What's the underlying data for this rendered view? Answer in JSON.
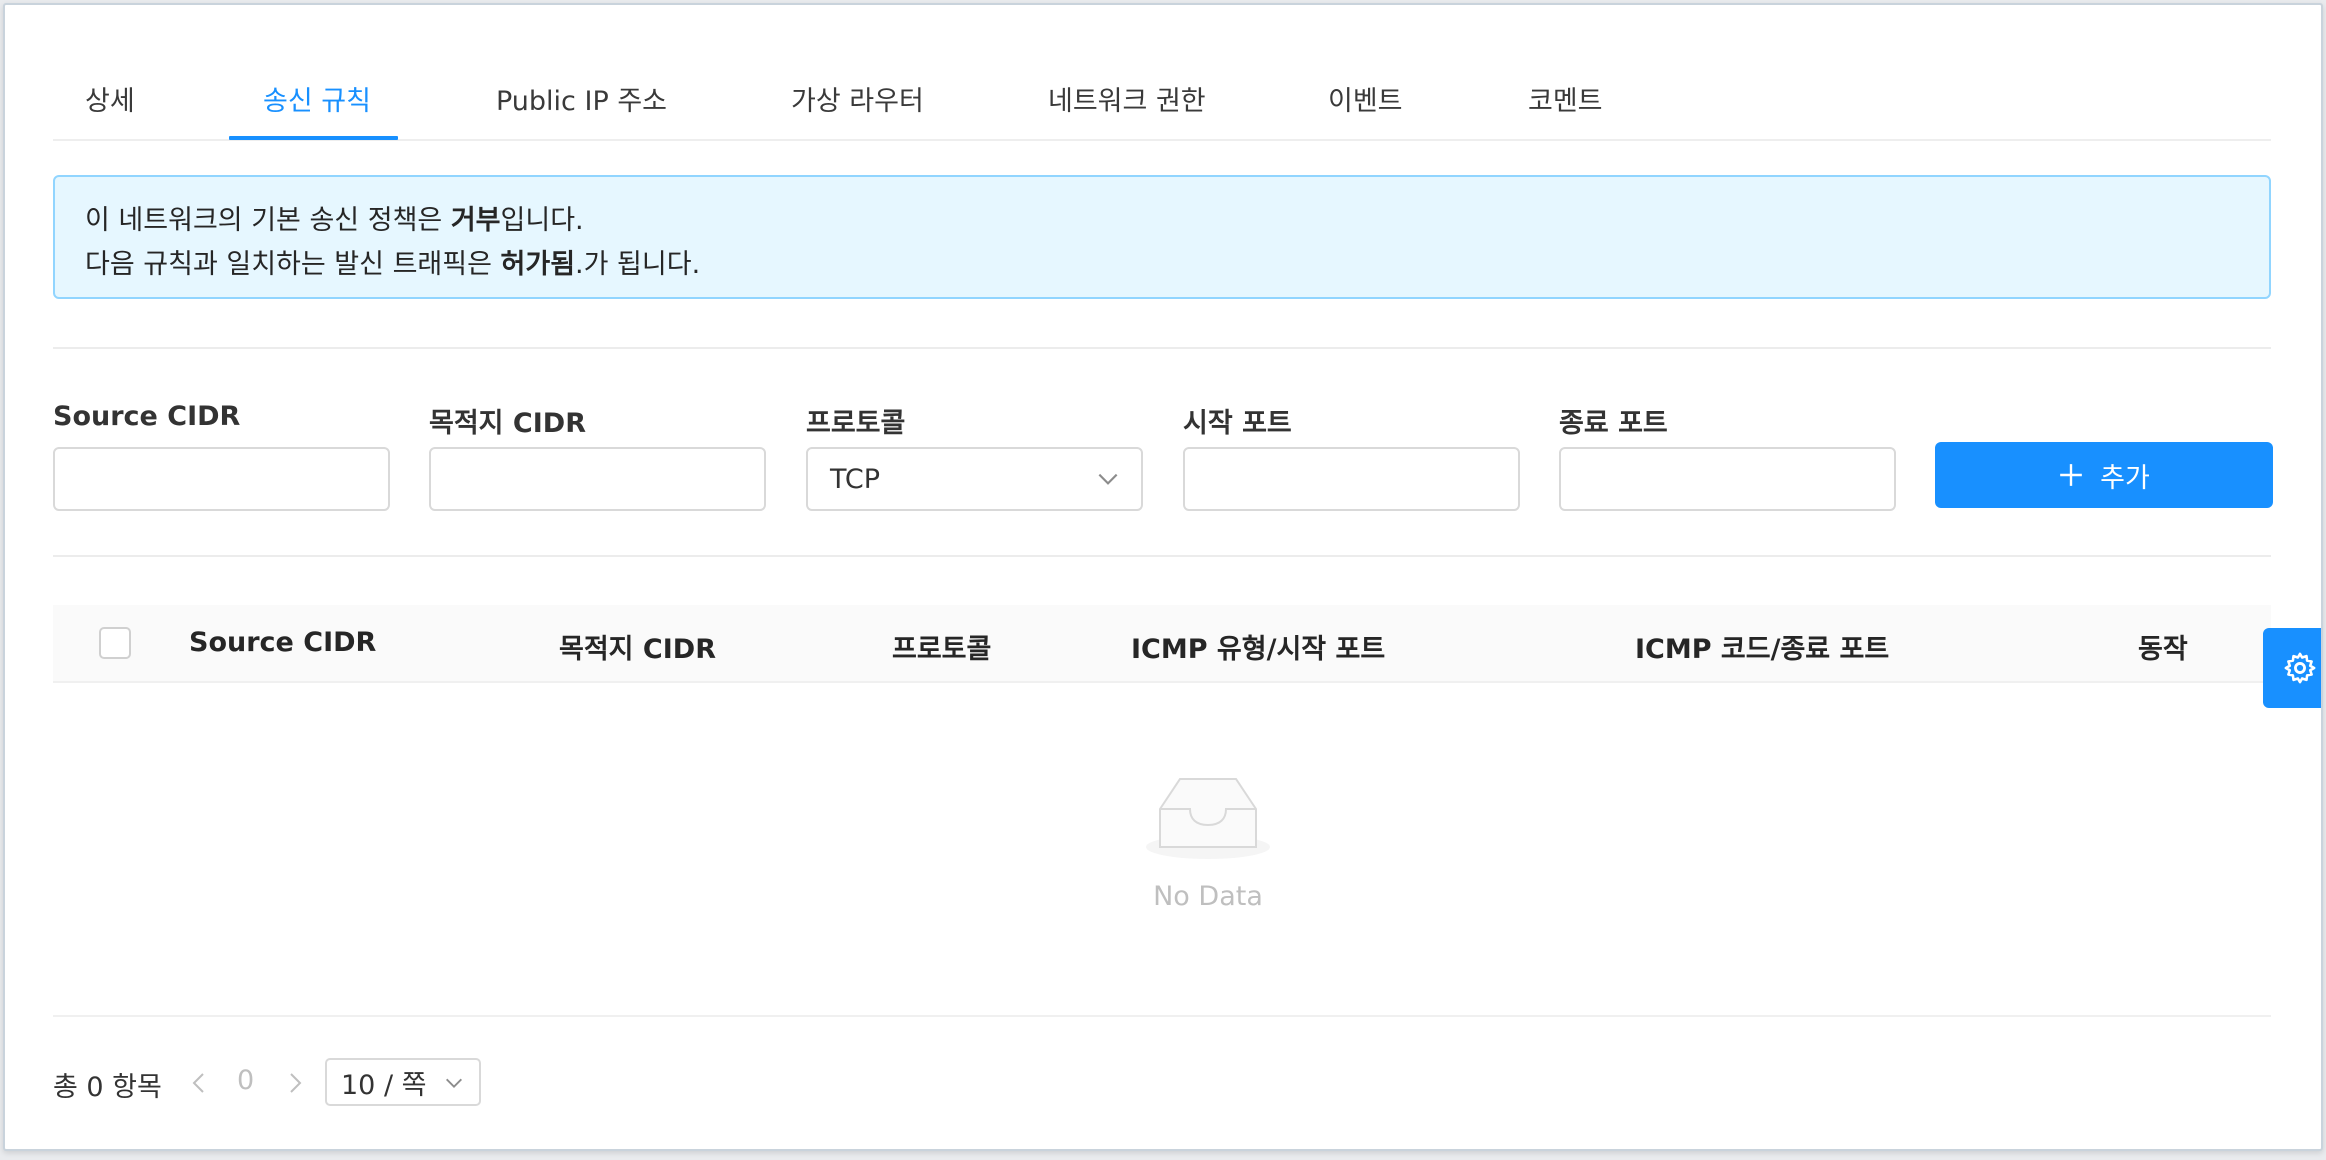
{
  "tabs": [
    {
      "label": "상세"
    },
    {
      "label": "송신 규칙",
      "active": true
    },
    {
      "label": "Public IP 주소"
    },
    {
      "label": "가상 라우터"
    },
    {
      "label": "네트워크 권한"
    },
    {
      "label": "이벤트"
    },
    {
      "label": "코멘트"
    }
  ],
  "alert": {
    "line1_prefix": "이 네트워크의 기본 송신 정책은 ",
    "line1_bold": "거부",
    "line1_suffix": "입니다.",
    "line2_prefix": "다음 규칙과 일치하는 발신 트래픽은 ",
    "line2_bold": "허가됨",
    "line2_suffix": ".가 됩니다."
  },
  "form": {
    "source_cidr_label": "Source CIDR",
    "source_cidr_value": "",
    "dest_cidr_label": "목적지 CIDR",
    "dest_cidr_value": "",
    "protocol_label": "프로토콜",
    "protocol_value": "TCP",
    "start_port_label": "시작 포트",
    "start_port_value": "",
    "end_port_label": "종료 포트",
    "end_port_value": "",
    "add_button_label": "추가"
  },
  "table": {
    "columns": [
      "Source CIDR",
      "목적지 CIDR",
      "프로토콜",
      "ICMP 유형/시작 포트",
      "ICMP 코드/종료 포트",
      "동작"
    ],
    "rows": [],
    "empty_text": "No Data"
  },
  "pagination": {
    "total_text": "총 0 항목",
    "current_page": "0",
    "page_size": "10 / 쪽"
  },
  "icons": {
    "add": "plus-icon",
    "settings": "gear-icon",
    "empty": "inbox-icon",
    "select": "chevron-down-icon",
    "prev": "chevron-left-icon",
    "next": "chevron-right-icon"
  },
  "colors": {
    "primary": "#1890ff",
    "alert_bg": "#e6f7ff",
    "alert_border": "#91d5ff"
  }
}
